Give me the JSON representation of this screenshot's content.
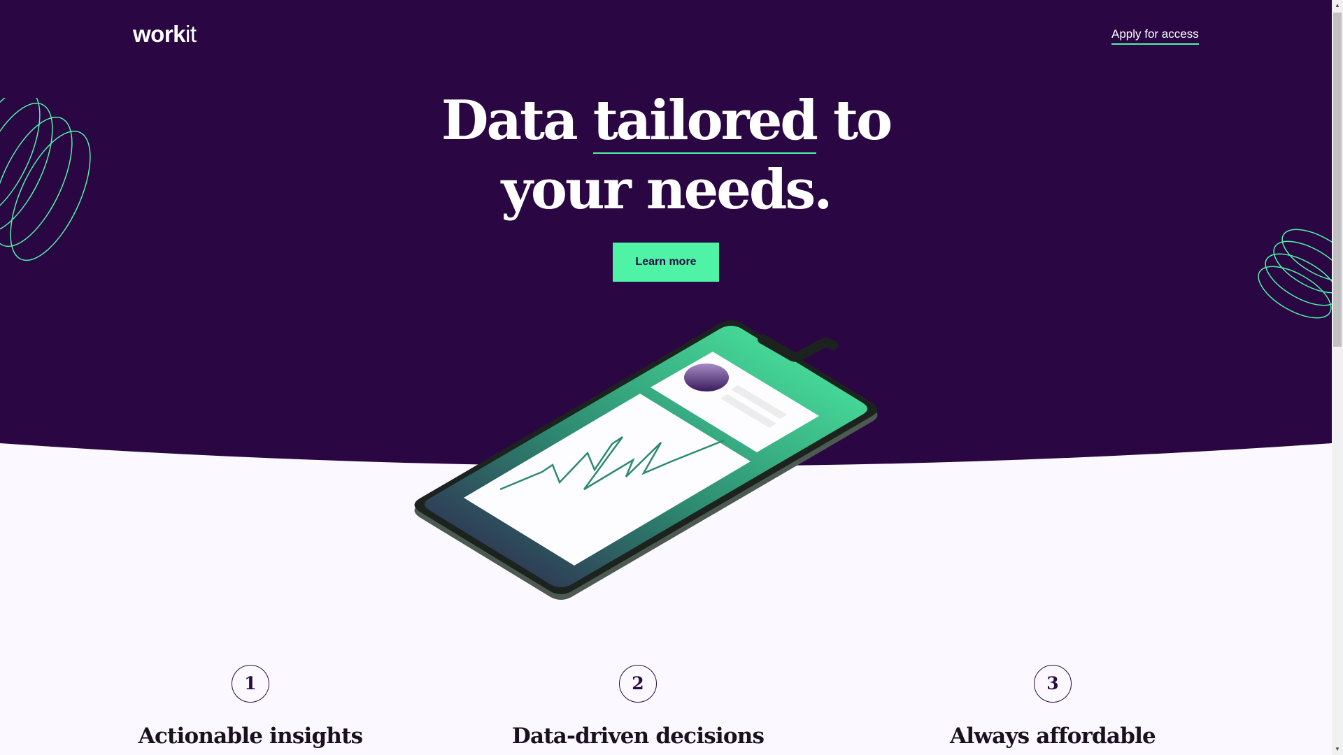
{
  "colors": {
    "hero_background": "#2a0643",
    "page_background": "#fbf8ff",
    "accent": "#4ef3a6",
    "text_dark": "#2a0b43"
  },
  "header": {
    "logo_bold": "work",
    "logo_light": "it",
    "apply_link": "Apply for access"
  },
  "hero": {
    "headline_word1": "Data ",
    "headline_accent": "tailored",
    "headline_line1_end": " to",
    "headline_line2": "your needs.",
    "cta_label": "Learn more",
    "image": "smartphone-mockup"
  },
  "features": [
    {
      "number": "1",
      "title": "Actionable insights"
    },
    {
      "number": "2",
      "title": "Data-driven decisions"
    },
    {
      "number": "3",
      "title": "Always affordable"
    }
  ],
  "scrollbar": {
    "up_icon": "arrow-up-icon",
    "down_icon": "arrow-down-icon"
  }
}
